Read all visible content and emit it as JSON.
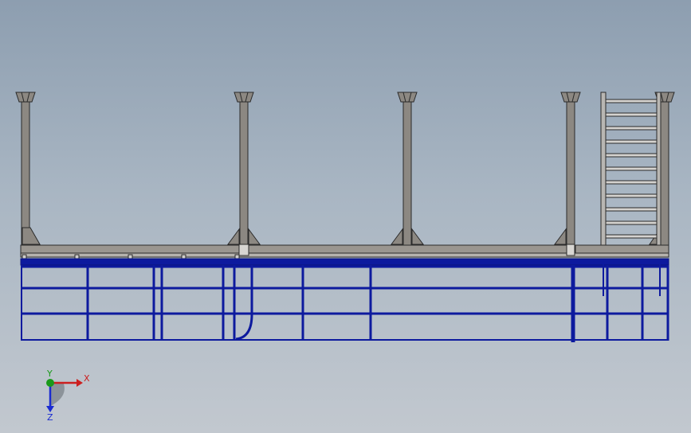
{
  "viewport": {
    "background_top": "#8d9eb0",
    "background_bottom": "#c2c8cf"
  },
  "colors": {
    "structure_fill": "#8c8882",
    "structure_edge": "#2a2a2a",
    "frame_blue": "#0d1a9e"
  },
  "triad": {
    "x_label": "X",
    "y_label": "Y",
    "z_label": "Z",
    "x_color": "#cc1f1f",
    "y_color": "#1a9a1a",
    "z_color": "#1a2bd1"
  }
}
